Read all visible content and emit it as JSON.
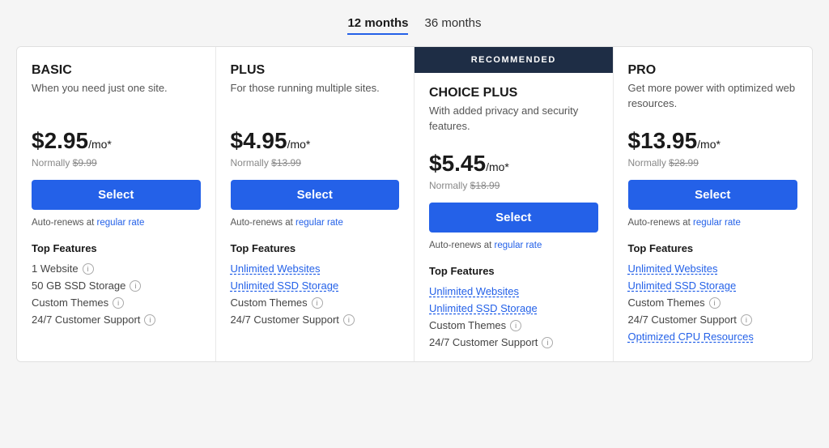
{
  "tabs": {
    "items": [
      {
        "label": "12 months",
        "active": true
      },
      {
        "label": "36 months",
        "active": false
      }
    ]
  },
  "plans": [
    {
      "id": "basic",
      "name": "BASIC",
      "desc": "When you need just one site.",
      "price_main": "$2.95",
      "price_suffix": "/mo*",
      "price_normal": "Normally $9.99",
      "select_label": "Select",
      "auto_renew": "Auto-renews at",
      "auto_renew_link": "regular rate",
      "recommended": false,
      "features_title": "Top Features",
      "features": [
        {
          "text": "1 Website",
          "link": false,
          "info": true,
          "dashed": false
        },
        {
          "text": "50 GB SSD Storage",
          "link": false,
          "info": true,
          "dashed": false
        },
        {
          "text": "Custom Themes",
          "link": false,
          "info": true,
          "dashed": false
        },
        {
          "text": "24/7 Customer Support",
          "link": false,
          "info": true,
          "dashed": false
        }
      ]
    },
    {
      "id": "plus",
      "name": "PLUS",
      "desc": "For those running multiple sites.",
      "price_main": "$4.95",
      "price_suffix": "/mo*",
      "price_normal": "Normally $13.99",
      "select_label": "Select",
      "auto_renew": "Auto-renews at",
      "auto_renew_link": "regular rate",
      "recommended": false,
      "features_title": "Top Features",
      "features": [
        {
          "text": "Unlimited Websites",
          "link": true,
          "info": false,
          "dashed": true
        },
        {
          "text": "Unlimited SSD Storage",
          "link": true,
          "info": false,
          "dashed": true
        },
        {
          "text": "Custom Themes",
          "link": false,
          "info": true,
          "dashed": false
        },
        {
          "text": "24/7 Customer Support",
          "link": false,
          "info": true,
          "dashed": false
        }
      ]
    },
    {
      "id": "choice-plus",
      "name": "CHOICE PLUS",
      "desc": "With added privacy and security features.",
      "price_main": "$5.45",
      "price_suffix": "/mo*",
      "price_normal": "Normally $18.99",
      "select_label": "Select",
      "auto_renew": "Auto-renews at",
      "auto_renew_link": "regular rate",
      "recommended": true,
      "recommended_label": "RECOMMENDED",
      "features_title": "Top Features",
      "features": [
        {
          "text": "Unlimited Websites",
          "link": false,
          "info": false,
          "dashed": false,
          "blue": true
        },
        {
          "text": "Unlimited SSD Storage",
          "link": false,
          "info": false,
          "dashed": false,
          "blue": true
        },
        {
          "text": "Custom Themes",
          "link": false,
          "info": true,
          "dashed": false
        },
        {
          "text": "24/7 Customer Support",
          "link": false,
          "info": true,
          "dashed": false
        }
      ]
    },
    {
      "id": "pro",
      "name": "PRO",
      "desc": "Get more power with optimized web resources.",
      "price_main": "$13.95",
      "price_suffix": "/mo*",
      "price_normal": "Normally $28.99",
      "select_label": "Select",
      "auto_renew": "Auto-renews at",
      "auto_renew_link": "regular rate",
      "recommended": false,
      "features_title": "Top Features",
      "features": [
        {
          "text": "Unlimited Websites",
          "link": false,
          "info": false,
          "dashed": false,
          "blue": true
        },
        {
          "text": "Unlimited SSD Storage",
          "link": false,
          "info": false,
          "dashed": false,
          "blue": true
        },
        {
          "text": "Custom Themes",
          "link": false,
          "info": true,
          "dashed": false
        },
        {
          "text": "24/7 Customer Support",
          "link": false,
          "info": true,
          "dashed": false
        },
        {
          "text": "Optimized CPU Resources",
          "link": true,
          "info": false,
          "dashed": true,
          "blue": true
        }
      ]
    }
  ],
  "colors": {
    "accent": "#2461e8",
    "recommended_bg": "#1e2d45"
  }
}
